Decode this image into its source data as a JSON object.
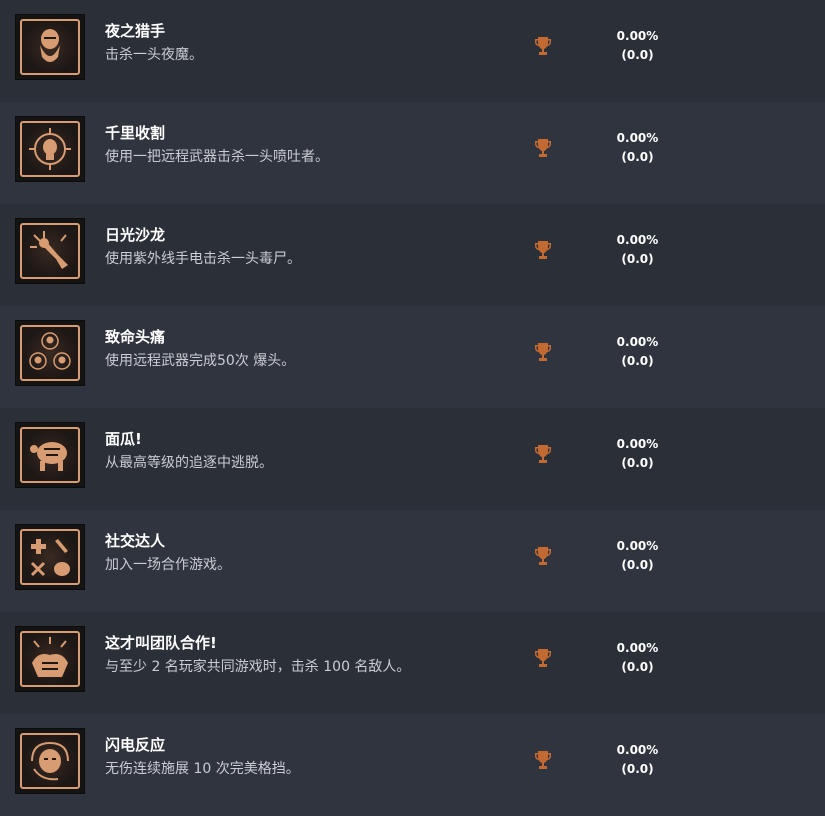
{
  "colors": {
    "accent": "#d79c71",
    "trophy": "#c26a32",
    "row_dark": "#2b2f38",
    "row_light": "#30343e"
  },
  "achievements": [
    {
      "icon": "bearded-face-icon",
      "title": "夜之猎手",
      "desc": "击杀一头夜魔。",
      "percent": "0.00%",
      "count": "(0.0)"
    },
    {
      "icon": "crosshair-skull-icon",
      "title": "千里收割",
      "desc": "使用一把远程武器击杀一头喷吐者。",
      "percent": "0.00%",
      "count": "(0.0)"
    },
    {
      "icon": "uv-flashlight-icon",
      "title": "日光沙龙",
      "desc": "使用紫外线手电击杀一头毒尸。",
      "percent": "0.00%",
      "count": "(0.0)"
    },
    {
      "icon": "triple-target-icon",
      "title": "致命头痛",
      "desc": "使用远程武器完成50次 爆头。",
      "percent": "0.00%",
      "count": "(0.0)"
    },
    {
      "icon": "turtle-escape-icon",
      "title": "面瓜!",
      "desc": "从最高等级的追逐中逃脱。",
      "percent": "0.00%",
      "count": "(0.0)"
    },
    {
      "icon": "class-symbols-icon",
      "title": "社交达人",
      "desc": "加入一场合作游戏。",
      "percent": "0.00%",
      "count": "(0.0)"
    },
    {
      "icon": "fist-bump-icon",
      "title": "这才叫团队合作!",
      "desc": "与至少 2 名玩家共同游戏时，击杀 100 名敌人。",
      "percent": "0.00%",
      "count": "(0.0)"
    },
    {
      "icon": "dodge-head-icon",
      "title": "闪电反应",
      "desc": "无伤连续施展 10 次完美格挡。",
      "percent": "0.00%",
      "count": "(0.0)"
    }
  ]
}
